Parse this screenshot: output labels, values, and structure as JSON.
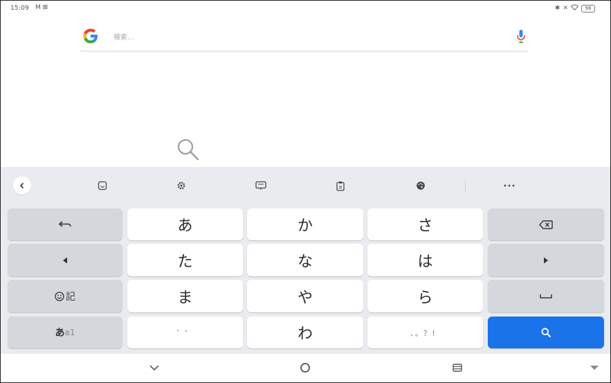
{
  "status_bar": {
    "time": "15:09",
    "left_icons": "M ⊠",
    "battery": "98"
  },
  "search": {
    "placeholder": "検索..."
  },
  "keyboard": {
    "rows": [
      [
        "あ",
        "か",
        "さ"
      ],
      [
        "た",
        "な",
        "は"
      ],
      [
        "ま",
        "や",
        "ら"
      ],
      [
        "",
        "わ",
        ""
      ]
    ],
    "emoji_key_label": "記",
    "mode_key_kana": "あ",
    "mode_key_alnum": "a1",
    "punct_key": "、。？！",
    "dakuten_key": "゛゜"
  },
  "colors": {
    "accent": "#1a73e8",
    "keyboard_bg": "#e9ebee",
    "dark_key": "#d4d7dc"
  }
}
